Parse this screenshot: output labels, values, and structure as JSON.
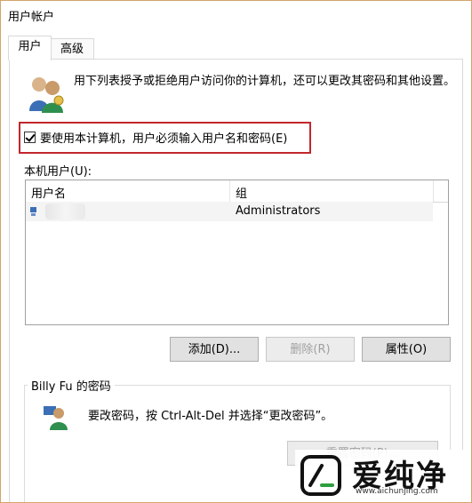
{
  "window": {
    "title": "用户帐户"
  },
  "tabs": [
    {
      "label": "用户"
    },
    {
      "label": "高级"
    }
  ],
  "intro_text": "用下列表授予或拒绝用户访问你的计算机，还可以更改其密码和其他设置。",
  "must_login_checkbox": {
    "label": "要使用本计算机，用户必须输入用户名和密码(E)",
    "checked": true
  },
  "users_label": "本机用户(U):",
  "table": {
    "columns": [
      "用户名",
      "组"
    ],
    "rows": [
      {
        "username": "",
        "group": "Administrators"
      }
    ]
  },
  "buttons": {
    "add": "添加(D)...",
    "remove": "删除(R)",
    "properties": "属性(O)",
    "reset_password": "重置密码(P)..."
  },
  "password_group": {
    "title": "Billy Fu 的密码",
    "text": "要改密码，按 Ctrl-Alt-Del 并选择“更改密码”。"
  },
  "watermark": {
    "brand": "爱纯净",
    "url": "www.aichunjing.com"
  },
  "icons": {
    "users": "users-icon",
    "user_row": "user-icon",
    "password": "user-key-icon",
    "logo": "logo-icon"
  }
}
